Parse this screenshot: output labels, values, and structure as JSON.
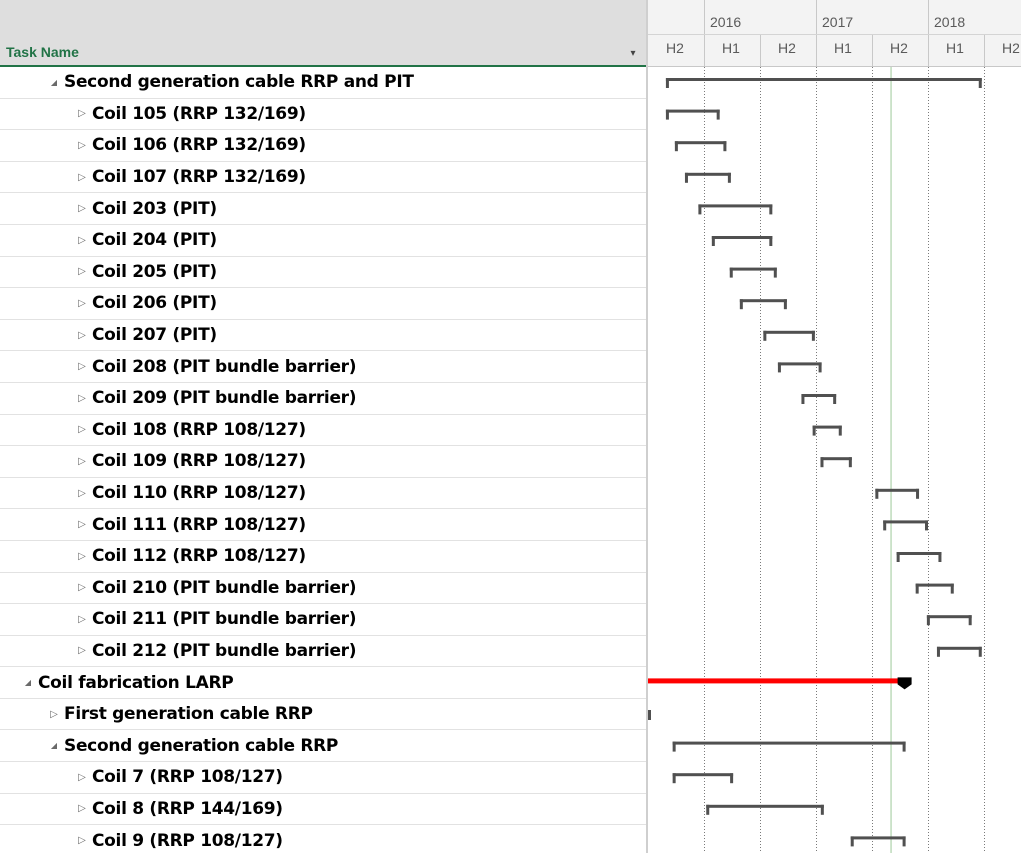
{
  "table": {
    "header": "Task Name",
    "dropdown_icon": "▾"
  },
  "timescale": {
    "years": [
      "2016",
      "2017",
      "2018"
    ],
    "halves": [
      "H2",
      "H1",
      "H2",
      "H1",
      "H2",
      "H1",
      "H2"
    ]
  },
  "tasks": [
    {
      "name": "Second generation cable RRP and PIT",
      "level": 2,
      "expanded": true
    },
    {
      "name": "Coil 105 (RRP 132/169)",
      "level": 3,
      "expanded": false
    },
    {
      "name": "Coil 106 (RRP 132/169)",
      "level": 3,
      "expanded": false
    },
    {
      "name": "Coil 107 (RRP 132/169)",
      "level": 3,
      "expanded": false
    },
    {
      "name": "Coil 203 (PIT)",
      "level": 3,
      "expanded": false
    },
    {
      "name": "Coil 204 (PIT)",
      "level": 3,
      "expanded": false
    },
    {
      "name": "Coil 205 (PIT)",
      "level": 3,
      "expanded": false
    },
    {
      "name": "Coil 206 (PIT)",
      "level": 3,
      "expanded": false
    },
    {
      "name": "Coil 207 (PIT)",
      "level": 3,
      "expanded": false
    },
    {
      "name": "Coil 208 (PIT bundle barrier)",
      "level": 3,
      "expanded": false
    },
    {
      "name": "Coil 209 (PIT bundle barrier)",
      "level": 3,
      "expanded": false
    },
    {
      "name": "Coil 108 (RRP 108/127)",
      "level": 3,
      "expanded": false
    },
    {
      "name": "Coil 109 (RRP 108/127)",
      "level": 3,
      "expanded": false
    },
    {
      "name": "Coil 110 (RRP 108/127)",
      "level": 3,
      "expanded": false
    },
    {
      "name": "Coil 111 (RRP 108/127)",
      "level": 3,
      "expanded": false
    },
    {
      "name": "Coil 112 (RRP 108/127)",
      "level": 3,
      "expanded": false
    },
    {
      "name": "Coil 210 (PIT bundle barrier)",
      "level": 3,
      "expanded": false
    },
    {
      "name": "Coil 211 (PIT bundle barrier)",
      "level": 3,
      "expanded": false
    },
    {
      "name": "Coil 212 (PIT bundle barrier)",
      "level": 3,
      "expanded": false
    },
    {
      "name": "Coil fabrication LARP",
      "level": 1,
      "expanded": true
    },
    {
      "name": "First generation cable RRP",
      "level": 2,
      "expanded": false
    },
    {
      "name": "Second generation cable RRP",
      "level": 2,
      "expanded": true
    },
    {
      "name": "Coil 7 (RRP 108/127)",
      "level": 3,
      "expanded": false
    },
    {
      "name": "Coil 8 (RRP 144/169)",
      "level": 3,
      "expanded": false
    },
    {
      "name": "Coil 9 (RRP 108/127)",
      "level": 3,
      "expanded": false
    }
  ],
  "gantt": {
    "summary_bars": [
      {
        "row": 0,
        "start": 2015.66,
        "end": 2018.48
      },
      {
        "row": 1,
        "start": 2015.66,
        "end": 2016.14
      },
      {
        "row": 2,
        "start": 2015.74,
        "end": 2016.2
      },
      {
        "row": 3,
        "start": 2015.83,
        "end": 2016.24
      },
      {
        "row": 4,
        "start": 2015.95,
        "end": 2016.61
      },
      {
        "row": 5,
        "start": 2016.07,
        "end": 2016.61
      },
      {
        "row": 6,
        "start": 2016.23,
        "end": 2016.65
      },
      {
        "row": 7,
        "start": 2016.32,
        "end": 2016.74
      },
      {
        "row": 8,
        "start": 2016.53,
        "end": 2016.99
      },
      {
        "row": 9,
        "start": 2016.66,
        "end": 2017.05
      },
      {
        "row": 10,
        "start": 2016.87,
        "end": 2017.18
      },
      {
        "row": 11,
        "start": 2016.97,
        "end": 2017.23
      },
      {
        "row": 12,
        "start": 2017.04,
        "end": 2017.32
      },
      {
        "row": 13,
        "start": 2017.53,
        "end": 2017.92
      },
      {
        "row": 14,
        "start": 2017.6,
        "end": 2018.0
      },
      {
        "row": 15,
        "start": 2017.72,
        "end": 2018.12
      },
      {
        "row": 16,
        "start": 2017.89,
        "end": 2018.23
      },
      {
        "row": 17,
        "start": 2017.99,
        "end": 2018.39
      },
      {
        "row": 18,
        "start": 2018.08,
        "end": 2018.48
      },
      {
        "row": 20,
        "start": 2015.23,
        "end": 2015.33
      },
      {
        "row": 21,
        "start": 2015.72,
        "end": 2017.8
      },
      {
        "row": 22,
        "start": 2015.72,
        "end": 2016.26
      },
      {
        "row": 23,
        "start": 2016.02,
        "end": 2017.07
      },
      {
        "row": 24,
        "start": 2017.31,
        "end": 2017.8
      }
    ],
    "critical_bars": [
      {
        "row": 19,
        "start": 2015.0,
        "end": 2017.8
      }
    ],
    "status_date": 2017.67,
    "colors": {
      "summary": "#505050",
      "critical": "#ff0000",
      "status_line": "#9dc89a",
      "gridline": "#7a7a7a"
    }
  }
}
